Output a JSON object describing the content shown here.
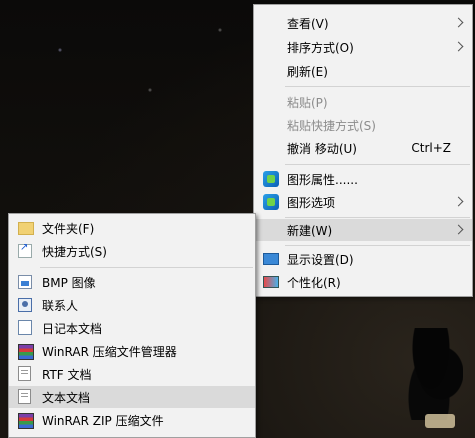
{
  "context_menu": {
    "items": [
      {
        "label": "查看(V)"
      },
      {
        "label": "排序方式(O)"
      },
      {
        "label": "刷新(E)"
      },
      {
        "label": "粘贴(P)"
      },
      {
        "label": "粘贴快捷方式(S)"
      },
      {
        "label": "撤消 移动(U)",
        "shortcut": "Ctrl+Z"
      },
      {
        "label": "图形属性......",
        "icon": "graphics-properties-icon"
      },
      {
        "label": "图形选项",
        "icon": "graphics-options-icon"
      },
      {
        "label": "新建(W)"
      },
      {
        "label": "显示设置(D)",
        "icon": "display-settings-icon"
      },
      {
        "label": "个性化(R)",
        "icon": "personalize-icon"
      }
    ]
  },
  "new_submenu": {
    "items": [
      {
        "label": "文件夹(F)",
        "icon": "folder-icon"
      },
      {
        "label": "快捷方式(S)",
        "icon": "shortcut-icon"
      },
      {
        "label": "BMP 图像",
        "icon": "bmp-image-icon"
      },
      {
        "label": "联系人",
        "icon": "contact-icon"
      },
      {
        "label": "日记本文档",
        "icon": "journal-icon"
      },
      {
        "label": "WinRAR 压缩文件管理器",
        "icon": "winrar-icon"
      },
      {
        "label": "RTF 文档",
        "icon": "rtf-document-icon"
      },
      {
        "label": "文本文档",
        "icon": "text-document-icon"
      },
      {
        "label": "WinRAR ZIP 压缩文件",
        "icon": "winrar-zip-icon"
      }
    ]
  }
}
